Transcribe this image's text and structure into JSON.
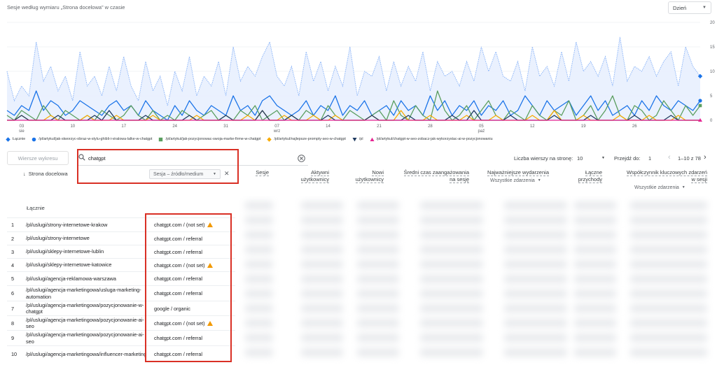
{
  "chart": {
    "title": "Sesje według wymiaru „Strona docelowa” w czasie",
    "granularity": "Dzień"
  },
  "chart_data": {
    "type": "line",
    "title": "Sesje według wymiaru „Strona docelowa” w czasie",
    "y_ticks": [
      "0",
      "5",
      "10",
      "15",
      "20"
    ],
    "ylim": [
      0,
      20
    ],
    "x_ticks": [
      {
        "label": "03",
        "sub": "sie",
        "index": 2
      },
      {
        "label": "10",
        "sub": "",
        "index": 9
      },
      {
        "label": "17",
        "sub": "",
        "index": 16
      },
      {
        "label": "24",
        "sub": "",
        "index": 23
      },
      {
        "label": "31",
        "sub": "",
        "index": 30
      },
      {
        "label": "07",
        "sub": "wrz",
        "index": 37
      },
      {
        "label": "14",
        "sub": "",
        "index": 44
      },
      {
        "label": "21",
        "sub": "",
        "index": 51
      },
      {
        "label": "28",
        "sub": "",
        "index": 58
      },
      {
        "label": "05",
        "sub": "paź",
        "index": 65
      },
      {
        "label": "12",
        "sub": "",
        "index": 72
      },
      {
        "label": "19",
        "sub": "",
        "index": 79
      },
      {
        "label": "26",
        "sub": "",
        "index": 86
      }
    ],
    "series": [
      {
        "name": "Łącznie",
        "color": "#8ab4f8",
        "style": "dotted-area",
        "values": [
          10,
          4,
          7,
          5,
          16,
          8,
          11,
          6,
          9,
          4,
          14,
          7,
          9,
          5,
          11,
          6,
          13,
          7,
          4,
          12,
          6,
          9,
          3,
          10,
          6,
          13,
          5,
          9,
          7,
          12,
          5,
          15,
          8,
          11,
          9,
          13,
          16,
          9,
          7,
          11,
          5,
          14,
          8,
          12,
          6,
          11,
          7,
          15,
          5,
          10,
          9,
          13,
          6,
          12,
          7,
          11,
          8,
          14,
          6,
          12,
          9,
          10,
          7,
          12,
          8,
          15,
          10,
          14,
          9,
          8,
          12,
          6,
          15,
          9,
          11,
          7,
          14,
          8,
          16,
          10,
          12,
          9,
          13,
          7,
          17,
          8,
          11,
          10,
          13,
          9,
          12,
          14,
          7,
          15,
          11,
          9
        ]
      },
      {
        "name": "/pl/artykul/jak-stworzyc-obraz-w-stylu-ghibli-i-viralowa-lalke-w-chatgpt",
        "color": "#1a73e8",
        "values": [
          2,
          1,
          3,
          2,
          6,
          2,
          4,
          3,
          1,
          2,
          4,
          3,
          2,
          1,
          3,
          4,
          2,
          3,
          1,
          4,
          2,
          1,
          0,
          3,
          1,
          4,
          2,
          1,
          3,
          2,
          1,
          5,
          2,
          3,
          1,
          4,
          5,
          3,
          2,
          1,
          2,
          4,
          1,
          3,
          2,
          5,
          1,
          3,
          2,
          4,
          1,
          2,
          3,
          1,
          4,
          2,
          3,
          1,
          5,
          2,
          4,
          1,
          3,
          2,
          4,
          1,
          3,
          2,
          4,
          1,
          2,
          5,
          3,
          1,
          4,
          2,
          3,
          4,
          1,
          3,
          5,
          2,
          4,
          1,
          2,
          3,
          1,
          4,
          2,
          5,
          3,
          2,
          4,
          3,
          2,
          4
        ]
      },
      {
        "name": "/pl/artykul/jak-pozycjonowac-swoja-marke-firme-w-chatgpt",
        "color": "#5a9e5f",
        "values": [
          1,
          0,
          2,
          1,
          0,
          3,
          1,
          0,
          2,
          1,
          0,
          1,
          0,
          2,
          1,
          0,
          1,
          3,
          1,
          0,
          2,
          0,
          1,
          0,
          2,
          1,
          0,
          1,
          2,
          0,
          1,
          0,
          2,
          1,
          3,
          0,
          1,
          2,
          0,
          1,
          0,
          2,
          1,
          0,
          3,
          1,
          0,
          2,
          1,
          0,
          1,
          2,
          0,
          4,
          1,
          0,
          3,
          1,
          0,
          6,
          2,
          0,
          1,
          3,
          0,
          2,
          4,
          1,
          0,
          2,
          1,
          0,
          3,
          1,
          0,
          2,
          1,
          4,
          0,
          1,
          3,
          0,
          2,
          5,
          1,
          0,
          3,
          2,
          0,
          1,
          4,
          2,
          0,
          3,
          1,
          3
        ]
      },
      {
        "name": "/pl/artykul/najlepsze-prompty-seo-w-chatgpt",
        "color": "#f9ab00",
        "values": [
          0,
          0,
          1,
          0,
          0,
          0,
          1,
          0,
          0,
          0,
          0,
          1,
          0,
          0,
          0,
          1,
          0,
          0,
          0,
          0,
          1,
          0,
          0,
          0,
          0,
          0,
          1,
          0,
          0,
          0,
          0,
          0,
          0,
          1,
          0,
          2,
          0,
          0,
          1,
          0,
          0,
          0,
          1,
          0,
          0,
          1,
          0,
          0,
          0,
          0,
          1,
          0,
          0,
          0,
          2,
          0,
          0,
          0,
          1,
          0,
          0,
          0,
          0,
          1,
          0,
          0,
          0,
          1,
          0,
          0,
          0,
          0,
          1,
          0,
          0,
          2,
          0,
          0,
          0,
          1,
          0,
          0,
          0,
          0,
          1,
          0,
          0,
          0,
          1,
          0,
          0,
          0,
          1,
          0,
          0,
          0
        ]
      },
      {
        "name": "/pl",
        "color": "#1f3a5f",
        "values": [
          0,
          0,
          1,
          0,
          0,
          0,
          0,
          1,
          0,
          0,
          0,
          0,
          1,
          0,
          2,
          0,
          0,
          0,
          0,
          1,
          0,
          0,
          0,
          0,
          0,
          1,
          0,
          0,
          0,
          0,
          1,
          0,
          0,
          0,
          0,
          2,
          0,
          0,
          0,
          1,
          0,
          0,
          0,
          0,
          1,
          0,
          0,
          0,
          0,
          0,
          1,
          0,
          0,
          0,
          0,
          1,
          0,
          0,
          0,
          0,
          0,
          1,
          0,
          0,
          2,
          0,
          0,
          0,
          0,
          1,
          0,
          0,
          0,
          0,
          0,
          1,
          0,
          0,
          0,
          0,
          1,
          0,
          0,
          0,
          0,
          0,
          1,
          0,
          0,
          0,
          0,
          1,
          0,
          0,
          0,
          0
        ]
      },
      {
        "name": "/pl/artykul/chatgpt-w-seo-zobacz-jak-wykorzystac-ai-w-pozycjonowaniu",
        "color": "#e52592",
        "values": [
          0,
          0,
          0,
          0,
          0,
          0,
          0,
          0,
          0,
          0,
          0,
          0,
          0,
          0,
          0,
          0,
          0,
          0,
          0,
          0,
          0,
          0,
          0,
          0,
          0,
          0,
          0,
          0,
          0,
          0,
          0,
          0,
          0,
          0,
          0,
          0,
          0,
          0,
          0,
          0,
          0,
          0,
          0,
          0,
          0,
          0,
          0,
          0,
          0,
          0,
          0,
          0,
          0,
          0,
          0,
          0,
          0,
          0,
          0,
          0,
          0,
          0,
          0,
          0,
          0,
          0,
          0,
          0,
          0,
          0,
          0,
          0,
          0,
          0,
          0,
          0,
          0,
          0,
          0,
          0,
          0,
          0,
          0,
          0,
          0,
          0,
          0,
          0,
          0,
          0,
          0,
          0,
          0,
          0,
          0,
          0
        ]
      }
    ]
  },
  "legend": [
    {
      "label": "Łącznie",
      "color": "#1a73e8",
      "marker": "diamond"
    },
    {
      "label": "/pl/artykul/jak-stworzyc-obraz-w-stylu-ghibli-i-viralowa-lalke-w-chatgpt",
      "color": "#1a73e8",
      "marker": "circle"
    },
    {
      "label": "/pl/artykul/jak-pozycjonowac-swoja-marke-firme-w-chatgpt",
      "color": "#5a9e5f",
      "marker": "square"
    },
    {
      "label": "/pl/artykul/najlepsze-prompty-seo-w-chatgpt",
      "color": "#f9ab00",
      "marker": "diamond"
    },
    {
      "label": "/pl",
      "color": "#1f3a5f",
      "marker": "triangle-down"
    },
    {
      "label": "/pl/artykul/chatgpt-w-seo-zobacz-jak-wykorzystac-ai-w-pozycjonowaniu",
      "color": "#e52592",
      "marker": "triangle"
    }
  ],
  "controls": {
    "plot_rows": "Wiersze wykresu",
    "search_value": "chatgpt",
    "secondary_dimension": "Sesja – źródło/medium",
    "rows_per_page_label": "Liczba wierszy na stronę:",
    "rows_per_page": "10",
    "goto_label": "Przejdź do:",
    "goto_value": "1",
    "page_range": "1–10 z 78"
  },
  "table": {
    "dimension_header": "Strona docelowa",
    "headers": {
      "sessions": "Sesje",
      "active_users_1": "Aktywni",
      "active_users_2": "użytkownicy",
      "new_users_1": "Nowi",
      "new_users_2": "użytkownicy",
      "engagement_1": "Średni czas zaangażowania",
      "engagement_2": "na sesję",
      "key_events": "Najważniejsze wydarzenia",
      "key_events_sub": "Wszystkie zdarzenia",
      "revenue_1": "Łączne",
      "revenue_2": "przychody",
      "key_rate_1": "Współczynnik kluczowych zdarzeń",
      "key_rate_2": "w sesji",
      "key_rate_sub": "Wszystkie zdarzenia"
    },
    "total_label": "Łącznie",
    "rows": [
      {
        "n": "1",
        "page": "/pl/uslugi/strony-internetowe-krakow",
        "src": "chatgpt.com / (not set)",
        "warn": true
      },
      {
        "n": "2",
        "page": "/pl/uslugi/strony-internetowe",
        "src": "chatgpt.com / referral",
        "warn": false
      },
      {
        "n": "3",
        "page": "/pl/uslugi/sklepy-internetowe-lublin",
        "src": "chatgpt.com / referral",
        "warn": false
      },
      {
        "n": "4",
        "page": "/pl/uslugi/sklepy-internetowe-katowice",
        "src": "chatgpt.com / (not set)",
        "warn": true
      },
      {
        "n": "5",
        "page": "/pl/uslugi/agencja-reklamowa-warszawa",
        "src": "chatgpt.com / referral",
        "warn": false
      },
      {
        "n": "6",
        "page": "/pl/uslugi/agencja-marketingowa/usluga-marketing-automation",
        "src": "chatgpt.com / referral",
        "warn": false
      },
      {
        "n": "7",
        "page": "/pl/uslugi/agencja-marketingowa/pozycjonowanie-w-chatgpt",
        "src": "google / organic",
        "warn": false
      },
      {
        "n": "8",
        "page": "/pl/uslugi/agencja-marketingowa/pozycjonowanie-ai-seo",
        "src": "chatgpt.com / (not set)",
        "warn": true
      },
      {
        "n": "9",
        "page": "/pl/uslugi/agencja-marketingowa/pozycjonowanie-ai-seo",
        "src": "chatgpt.com / referral",
        "warn": false
      },
      {
        "n": "10",
        "page": "/pl/uslugi/agencja-marketingowa/influencer-marketing",
        "src": "chatgpt.com / referral",
        "warn": false
      }
    ]
  }
}
